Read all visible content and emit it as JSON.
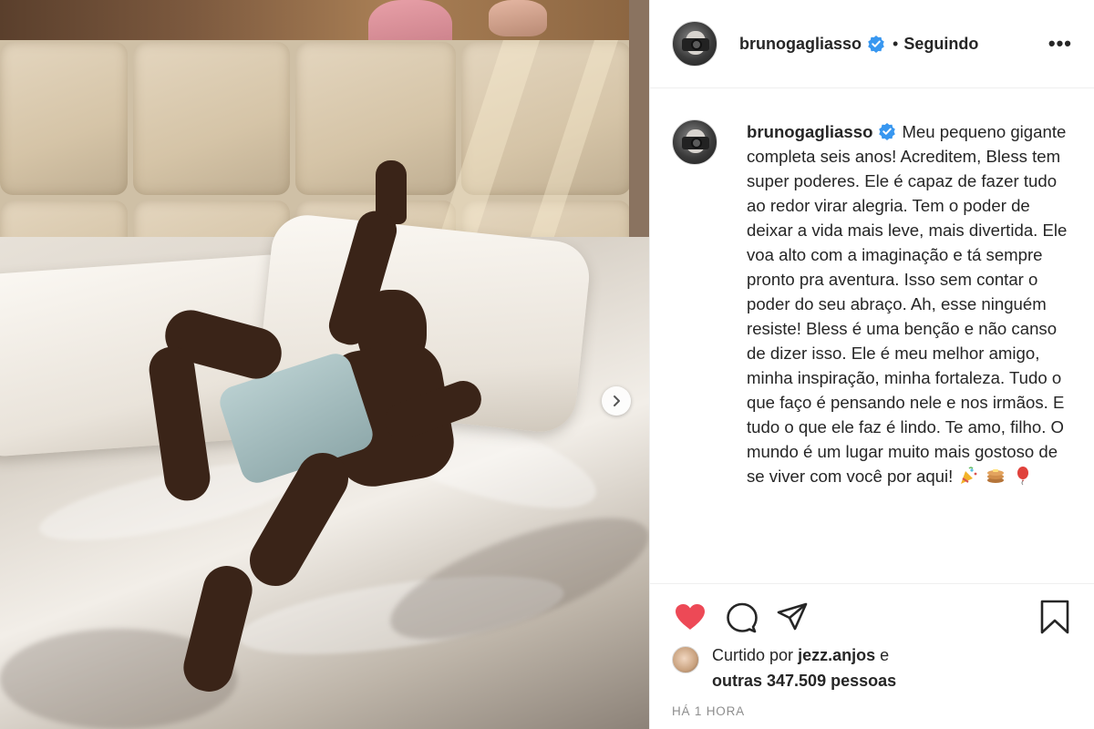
{
  "post": {
    "username": "brunogagliasso",
    "following_label": "Seguindo",
    "separator": "•",
    "more_label": "•••",
    "caption_body": "Meu pequeno gigante completa seis anos! Acreditem, Bless tem super poderes. Ele é capaz de fazer tudo ao redor virar alegria. Tem o poder de deixar a vida mais leve, mais divertida. Ele voa alto com a imaginação e tá sempre pronto pra aventura. Isso sem contar o poder do seu abraço. Ah, esse ninguém resiste! Bless é uma benção e não canso de dizer isso. Ele é meu melhor amigo, minha inspiração, minha fortaleza. Tudo o que faço é pensando nele e nos irmãos. E tudo o que ele faz é lindo. Te amo, filho. O mundo é um lugar muito mais gostoso de se viver com você por aqui!",
    "caption_emojis": [
      "party-popper",
      "pancakes",
      "balloon"
    ],
    "liked_by_prefix": "Curtido por",
    "liked_by_user": "jezz.anjos",
    "liked_by_conj": "e",
    "liked_by_others": "outras 347.509 pessoas",
    "timestamp": "HÁ 1 HORA"
  },
  "colors": {
    "like_red": "#ed4956",
    "verified_blue": "#3897f0",
    "text": "#262626",
    "muted": "#8e8e8e"
  },
  "icons": [
    "verified-badge-icon",
    "heart-icon",
    "comment-icon",
    "share-icon",
    "bookmark-icon",
    "chevron-right-icon"
  ]
}
